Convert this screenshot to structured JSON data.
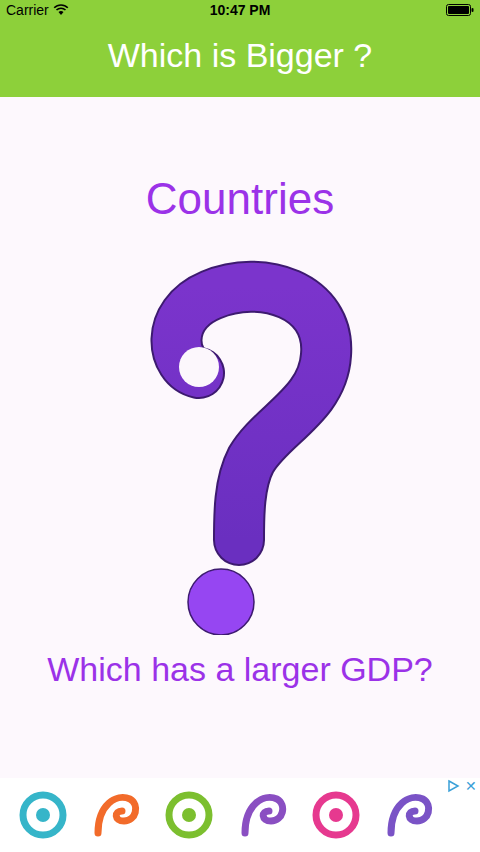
{
  "status_bar": {
    "carrier": "Carrier",
    "time": "10:47 PM"
  },
  "header": {
    "title": "Which is Bigger ?"
  },
  "category": "Countries",
  "question": "Which has a larger GDP?",
  "ad": {
    "icons": [
      {
        "color": "#36b5c9"
      },
      {
        "color": "#f26b2a"
      },
      {
        "color": "#7cbf2f"
      },
      {
        "color": "#8a4fc2"
      },
      {
        "color": "#e6398f"
      },
      {
        "color": "#7a53c6"
      }
    ],
    "close": "✕"
  }
}
